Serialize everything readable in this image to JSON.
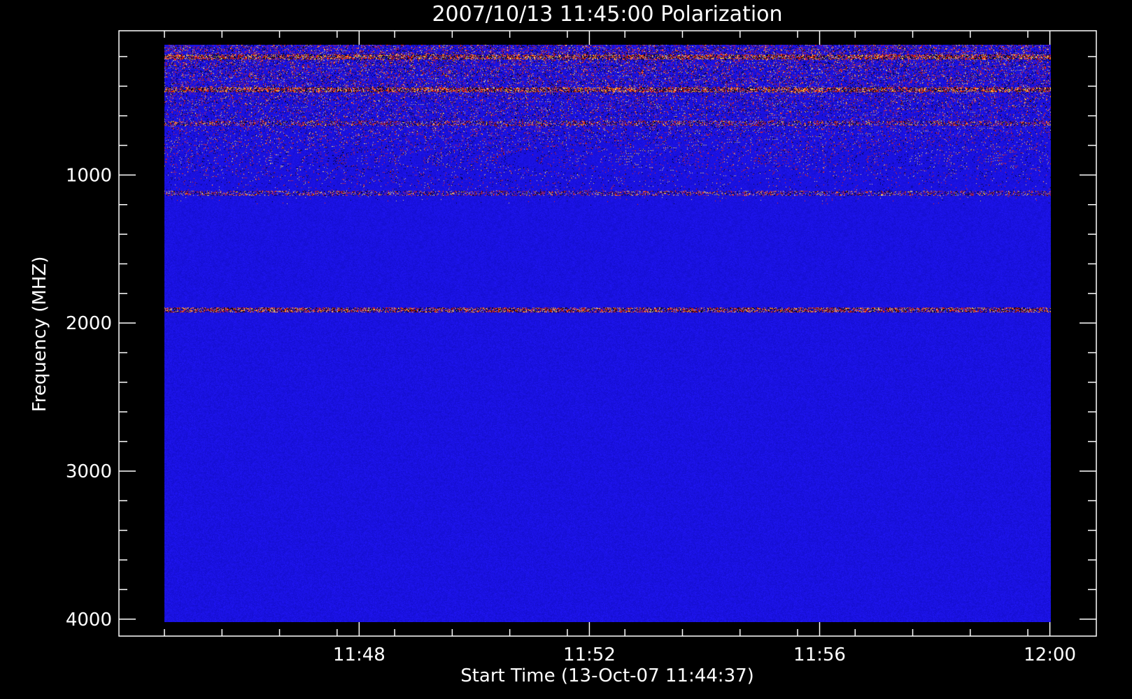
{
  "chart_data": {
    "type": "heatmap",
    "title": "2007/10/13 11:45:00 Polarization",
    "xlabel": "Start Time (13-Oct-07 11:44:37)",
    "ylabel": "Frequency (MHZ)",
    "x_tick_labels": [
      "11:48",
      "11:52",
      "11:56",
      "12:00"
    ],
    "x_ticks_minutes": [
      3.383,
      7.383,
      11.383,
      15.383
    ],
    "x_range_minutes": [
      0,
      15.4
    ],
    "y_tick_labels": [
      "1000",
      "2000",
      "3000",
      "4000"
    ],
    "y_ticks": [
      1000,
      2000,
      3000,
      4000
    ],
    "ylim": [
      120,
      4020
    ],
    "y_inverted": true,
    "colormap": {
      "background": "#1a12e0",
      "low": "#000000",
      "mid": "#ff2a00",
      "high": "#ffe066"
    },
    "features": [
      {
        "frequency_mhz": 200,
        "description": "dense RFI band",
        "intensity": "high"
      },
      {
        "frequency_mhz": 420,
        "description": "bright RFI line",
        "intensity": "high"
      },
      {
        "frequency_mhz": 650,
        "description": "RFI line",
        "intensity": "mid"
      },
      {
        "frequency_mhz": 1120,
        "description": "sparse RFI",
        "intensity": "mid"
      },
      {
        "frequency_mhz": 1910,
        "description": "strong alternating band",
        "intensity": "high"
      }
    ]
  }
}
